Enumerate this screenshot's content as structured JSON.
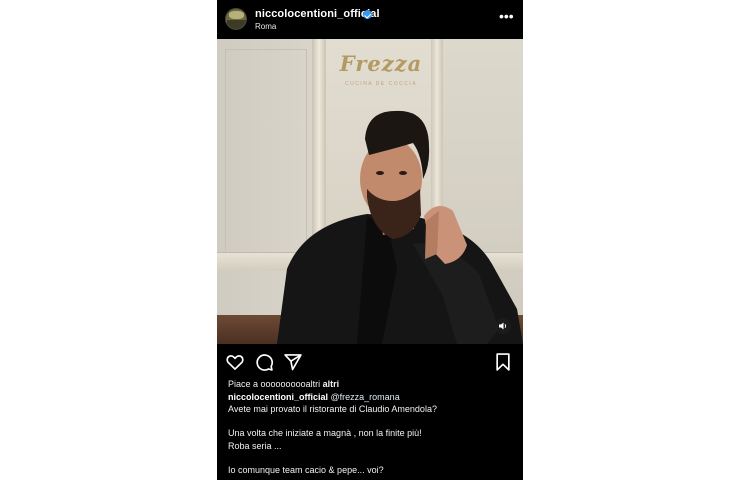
{
  "post": {
    "username": "niccolocentioni_official",
    "location": "Roma",
    "likes_prefix": "Piace a ",
    "likes_users": "oooooooooaltri",
    "likes_suffix": " altri",
    "caption_username": "niccolocentioni_official",
    "caption_mention": "@frezza_romana",
    "caption_lines": [
      "Avete mai provato il ristorante di Claudio Amendola?",
      "Una volta che iniziate a magnà , non la finite più!",
      "Roba seria ...",
      "Io comunque team cacio & pepe... voi?"
    ]
  },
  "photo": {
    "sign_text": "Frezza",
    "sign_subtext": "CUCINA DE COCCIA"
  },
  "icons": {
    "more": "more-options-icon",
    "verified": "verified-badge-icon",
    "like": "heart-icon",
    "comment": "comment-icon",
    "share": "send-icon",
    "save": "bookmark-icon",
    "sound": "speaker-icon"
  },
  "colors": {
    "background": "#000000",
    "verified": "#3897f0",
    "sign": "#b39a62"
  }
}
